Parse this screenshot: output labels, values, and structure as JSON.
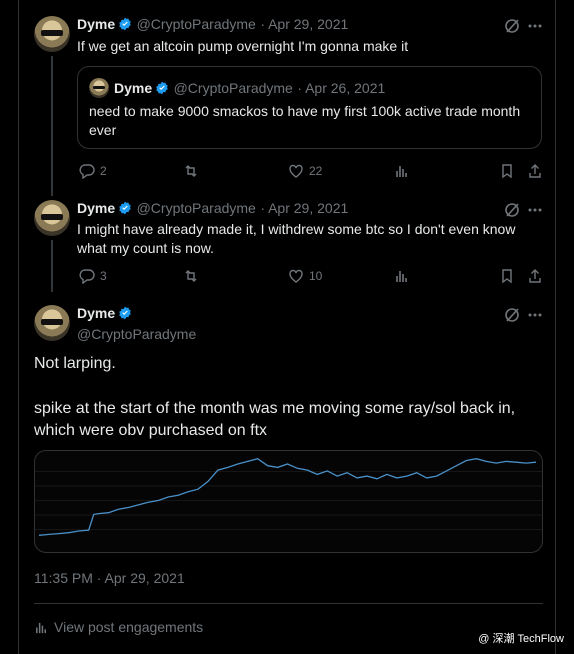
{
  "tweet1": {
    "name": "Dyme",
    "handle": "@CryptoParadyme",
    "date": "· Apr 29, 2021",
    "text": "If we get an altcoin pump overnight I'm gonna make it",
    "quote": {
      "name": "Dyme",
      "handle": "@CryptoParadyme",
      "date": "· Apr 26, 2021",
      "text": "need to make 9000 smackos to have my first 100k active trade month ever"
    },
    "replies": "2",
    "retweets": "",
    "likes": "22"
  },
  "tweet2": {
    "name": "Dyme",
    "handle": "@CryptoParadyme",
    "date": "· Apr 29, 2021",
    "text": "I might have already made it, I withdrew some btc so I don't even know what my count is now.",
    "replies": "3",
    "retweets": "",
    "likes": "10"
  },
  "main": {
    "name": "Dyme",
    "handle": "@CryptoParadyme",
    "line1": "Not larping.",
    "line2": "spike at the start of the month was me moving some ray/sol back in, which were obv purchased on ftx",
    "timestamp": "11:35 PM · Apr 29, 2021",
    "engagements": "View post engagements"
  },
  "watermark": "@ 深潮 TechFlow",
  "icons": [
    "grok-icon",
    "more-icon",
    "reply-icon",
    "retweet-icon",
    "like-icon",
    "views-icon",
    "bookmark-icon",
    "share-icon",
    "verified-badge-icon"
  ],
  "chart_data": {
    "type": "line",
    "color": "#4a90c8",
    "x": [
      0,
      2,
      4,
      6,
      8,
      10,
      11,
      12,
      14,
      16,
      18,
      20,
      22,
      24,
      26,
      28,
      30,
      32,
      34,
      36,
      38,
      40,
      42,
      44,
      46,
      48,
      50,
      52,
      54,
      56,
      58,
      60,
      62,
      64,
      66,
      68,
      70,
      72,
      74,
      76,
      78,
      80,
      82,
      84,
      86,
      88,
      90,
      92,
      94,
      96,
      98,
      100
    ],
    "values": [
      10,
      11,
      12,
      13,
      15,
      16,
      34,
      35,
      36,
      40,
      42,
      45,
      48,
      50,
      54,
      56,
      60,
      63,
      72,
      85,
      88,
      92,
      95,
      98,
      90,
      88,
      92,
      87,
      85,
      80,
      84,
      78,
      82,
      76,
      78,
      75,
      80,
      76,
      78,
      82,
      76,
      78,
      84,
      90,
      96,
      98,
      95,
      93,
      95,
      94,
      93,
      94
    ]
  }
}
